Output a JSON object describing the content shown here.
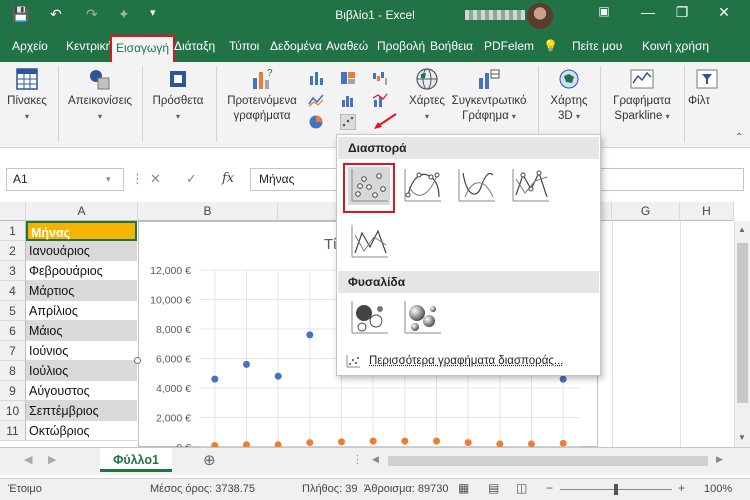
{
  "titlebar": {
    "title": "Βιβλίο1  -  Excel",
    "minimize": "—",
    "restore": "❐",
    "close": "✕",
    "ribbon_toggle": "▣"
  },
  "tabs": [
    "Αρχείο",
    "Κεντρική",
    "Εισαγωγή",
    "Διάταξη",
    "Τύποι",
    "Δεδομένα",
    "Αναθεώ",
    "Προβολή",
    "Βοήθεια",
    "PDFelem",
    "Πείτε μου",
    "Κοινή χρήση"
  ],
  "active_tab": "Εισαγωγή",
  "ribbon": {
    "tables": "Πίνακες",
    "illustrations": "Απεικονίσεις",
    "addins": "Πρόσθετα",
    "recommended_charts": [
      "Προτεινόμενα",
      "γραφήματα"
    ],
    "maps": "Χάρτες",
    "pivot_chart": [
      "Συγκεντρωτικό",
      "Γράφημα"
    ],
    "map3d": [
      "Χάρτης",
      "3D"
    ],
    "sparklines": [
      "Γραφήματα",
      "Sparkline"
    ],
    "filters": "Φίλτ"
  },
  "formula": {
    "namebox": "A1",
    "content": "Μήνας",
    "cancel": "✕",
    "enter": "✓",
    "fx": "fx"
  },
  "columns": [
    "A",
    "B",
    "G",
    "H"
  ],
  "rows": [
    {
      "num": "1",
      "value": "Μήνας"
    },
    {
      "num": "2",
      "value": "Ιανουάριος"
    },
    {
      "num": "3",
      "value": "Φεβρουάριος"
    },
    {
      "num": "4",
      "value": "Μάρτιος"
    },
    {
      "num": "5",
      "value": "Απρίλιος"
    },
    {
      "num": "6",
      "value": "Μάιος"
    },
    {
      "num": "7",
      "value": "Ιούνιος"
    },
    {
      "num": "8",
      "value": "Ιούλιος"
    },
    {
      "num": "9",
      "value": "Αύγουστος"
    },
    {
      "num": "10",
      "value": "Σεπτέμβριος"
    },
    {
      "num": "11",
      "value": "Οκτώβριος"
    }
  ],
  "colors": {
    "excel_green": "#217346",
    "header_fill": "#f4b400",
    "alt_row": "#d9d9d9",
    "blue_series": "#4472c4",
    "orange_series": "#ed7d31",
    "highlight": "#e0141e"
  },
  "chart_data": {
    "type": "scatter",
    "title": "Τίτλο",
    "ylim": [
      0,
      12000
    ],
    "ytick_labels": [
      "12,000 €",
      "10,000 €",
      "8,000 €",
      "6,000 €",
      "4,000 €",
      "2,000 €",
      "0 €"
    ],
    "yticks": [
      12000,
      10000,
      8000,
      6000,
      4000,
      2000,
      0
    ],
    "xlim": [
      0.5,
      12.5
    ],
    "series": [
      {
        "color": "#4472c4",
        "points": [
          [
            1,
            4600
          ],
          [
            2,
            5600
          ],
          [
            3,
            4800
          ],
          [
            4,
            7600
          ],
          [
            12,
            4600
          ]
        ]
      },
      {
        "color": "#ed7d31",
        "points": [
          [
            1,
            100
          ],
          [
            2,
            150
          ],
          [
            3,
            150
          ],
          [
            4,
            300
          ],
          [
            5,
            350
          ],
          [
            6,
            400
          ],
          [
            7,
            400
          ],
          [
            8,
            400
          ],
          [
            9,
            300
          ],
          [
            10,
            200
          ],
          [
            11,
            200
          ],
          [
            12,
            250
          ]
        ]
      }
    ],
    "grid": true
  },
  "dropdown": {
    "scatter_header": "Διασπορά",
    "bubble_header": "Φυσαλίδα",
    "more": "Περισσότερα γραφήματα διασποράς..."
  },
  "sheet": {
    "tab": "Φύλλο1",
    "add": "⊕"
  },
  "status": {
    "ready": "Έτοιμο",
    "average": "Μέσος όρος: 3738.75",
    "count": "Πλήθος: 39",
    "sum": "Άθροισμα: 89730",
    "zoom": "100%"
  }
}
